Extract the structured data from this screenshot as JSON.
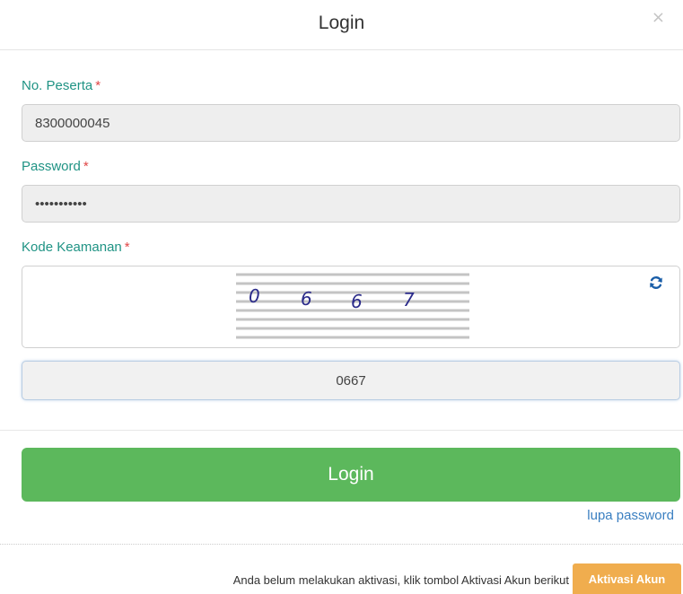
{
  "modal": {
    "title": "Login",
    "close_label": "×"
  },
  "form": {
    "participant_label": "No. Peserta",
    "participant_value": "8300000045",
    "password_label": "Password",
    "password_value": "abcdefghijk",
    "captcha_label": "Kode Keamanan",
    "captcha_digits": [
      "0",
      "6",
      "6",
      "7"
    ],
    "captcha_value": "0667",
    "required_marker": "*",
    "refresh_icon": "refresh-icon"
  },
  "actions": {
    "login_label": "Login",
    "forgot_password_label": "lupa password",
    "activation_prompt": "Anda belum melakukan aktivasi, klik tombol Aktivasi Akun berikut",
    "activation_label": "Aktivasi Akun"
  },
  "colors": {
    "label": "#1f9384",
    "required": "#e04545",
    "login_button": "#5cb85c",
    "activation_button": "#f0ad4e",
    "link": "#3a7fc1",
    "captcha_digits": "#2a2a8a"
  }
}
